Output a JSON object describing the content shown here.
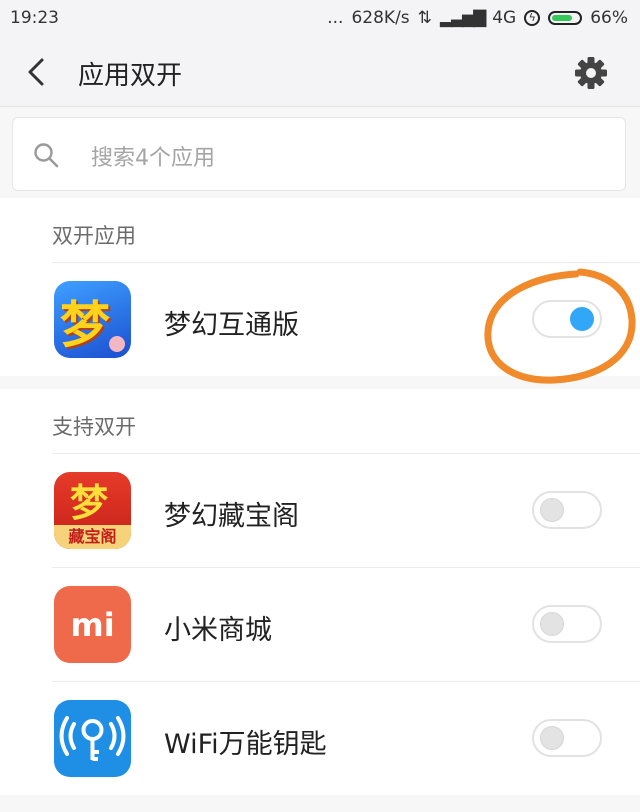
{
  "status_bar": {
    "time": "19:23",
    "dots": "...",
    "speed": "628K/s",
    "network": "4G",
    "battery": "66%"
  },
  "header": {
    "title": "应用双开"
  },
  "search": {
    "placeholder": "搜索4个应用"
  },
  "sections": [
    {
      "title": "双开应用",
      "items": [
        {
          "name": "梦幻互通版",
          "icon": "menghuan-icon",
          "enabled": true
        }
      ]
    },
    {
      "title": "支持双开",
      "items": [
        {
          "name": "梦幻藏宝阁",
          "icon": "cangbaoge-icon",
          "enabled": false
        },
        {
          "name": "小米商城",
          "icon": "mi-store-icon",
          "enabled": false
        },
        {
          "name": "WiFi万能钥匙",
          "icon": "wifi-key-icon",
          "enabled": false
        }
      ]
    }
  ],
  "icon_glyphs": {
    "menghuan": "梦",
    "cangbaoge_top": "梦",
    "cangbaoge_bottom": "藏宝阁",
    "mi": "mi"
  },
  "colors": {
    "toggle_on": "#33a7f7",
    "annotation": "#f08a2a",
    "mi_store": "#ef6a4a",
    "wifi_key": "#1f8fe6"
  }
}
